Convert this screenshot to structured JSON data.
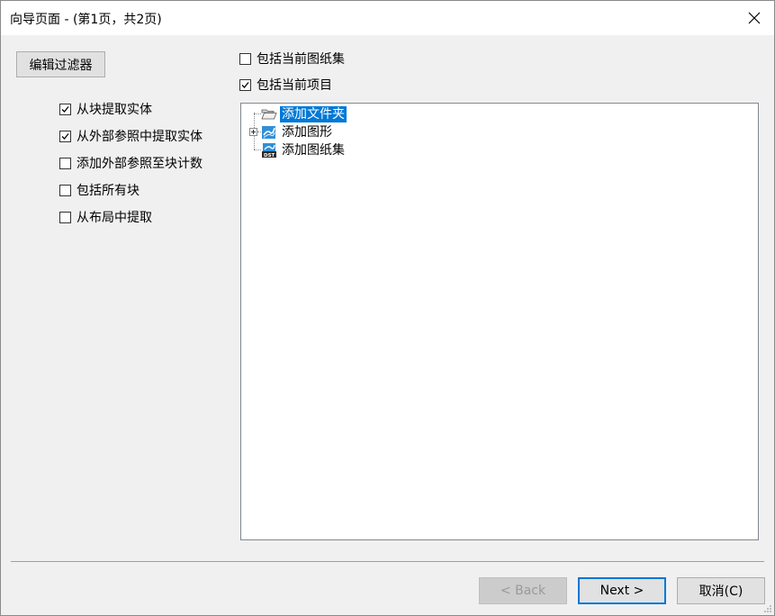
{
  "window": {
    "title": "向导页面 - (第1页，共2页)"
  },
  "toolbar": {
    "edit_filter_label": "编辑过滤器"
  },
  "options": [
    {
      "label": "从块提取实体",
      "checked": true
    },
    {
      "label": "从外部参照中提取实体",
      "checked": true
    },
    {
      "label": "添加外部参照至块计数",
      "checked": false
    },
    {
      "label": "包括所有块",
      "checked": false
    },
    {
      "label": "从布局中提取",
      "checked": false
    }
  ],
  "include": {
    "sheet_set": {
      "label": "包括当前图纸集",
      "checked": false
    },
    "project": {
      "label": "包括当前项目",
      "checked": true
    }
  },
  "tree": {
    "items": [
      {
        "label": "添加文件夹",
        "icon": "folder-open-icon",
        "selected": true
      },
      {
        "label": "添加图形",
        "icon": "drawing-icon",
        "selected": false,
        "expandable": true
      },
      {
        "label": "添加图纸集",
        "icon": "dst-sheetset-icon",
        "selected": false
      }
    ]
  },
  "footer": {
    "back_label": "< Back",
    "next_label": "Next >",
    "cancel_label": "取消(C)"
  },
  "colors": {
    "accent": "#0078d7",
    "selection": "#0078d7"
  }
}
